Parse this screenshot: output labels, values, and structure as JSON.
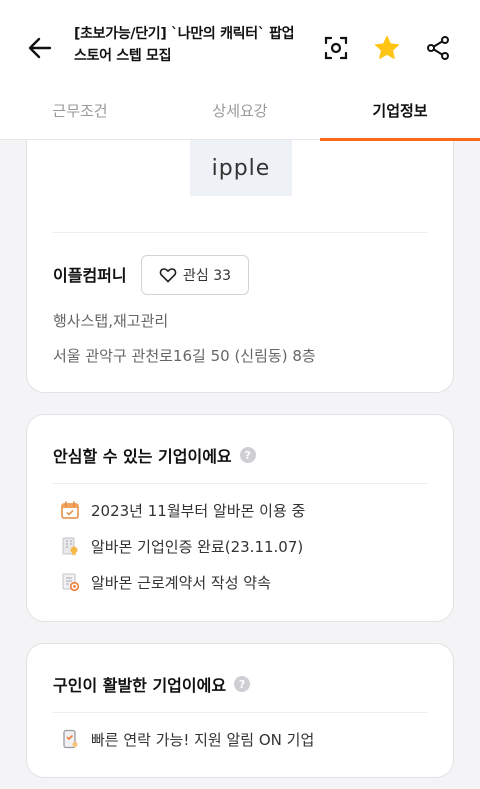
{
  "header": {
    "title": "[초보가능/단기] `나만의 캐릭터` 팝업스토어 스텝 모집",
    "back_icon": "arrow-left-icon",
    "scan_icon": "scan-icon",
    "star_icon": "star-icon",
    "share_icon": "share-icon",
    "star_color": "#ffc414"
  },
  "tabs": [
    {
      "label": "근무조건"
    },
    {
      "label": "상세요강"
    },
    {
      "label": "기업정보"
    }
  ],
  "accent_color": "#ff6a1a",
  "company": {
    "logo_text": "ipple",
    "name": "이플컴퍼니",
    "interest_label": "관심 33",
    "industry": "행사스탭,재고관리",
    "address": "서울 관악구 관천로16길 50 (신림동) 8층"
  },
  "trust": {
    "title": "안심할 수 있는 기업이에요",
    "items": [
      {
        "icon": "calendar-icon",
        "text": "2023년 11월부터 알바몬 이용 중"
      },
      {
        "icon": "building-badge-icon",
        "text": "알바몬 기업인증 완료(23.11.07)"
      },
      {
        "icon": "contract-icon",
        "text": "알바몬 근로계약서 작성 약속"
      }
    ]
  },
  "active": {
    "title": "구인이 활발한 기업이에요",
    "items": [
      {
        "icon": "phone-icon",
        "text": "빠른 연락 가능! 지원 알림 ON 기업"
      }
    ]
  }
}
